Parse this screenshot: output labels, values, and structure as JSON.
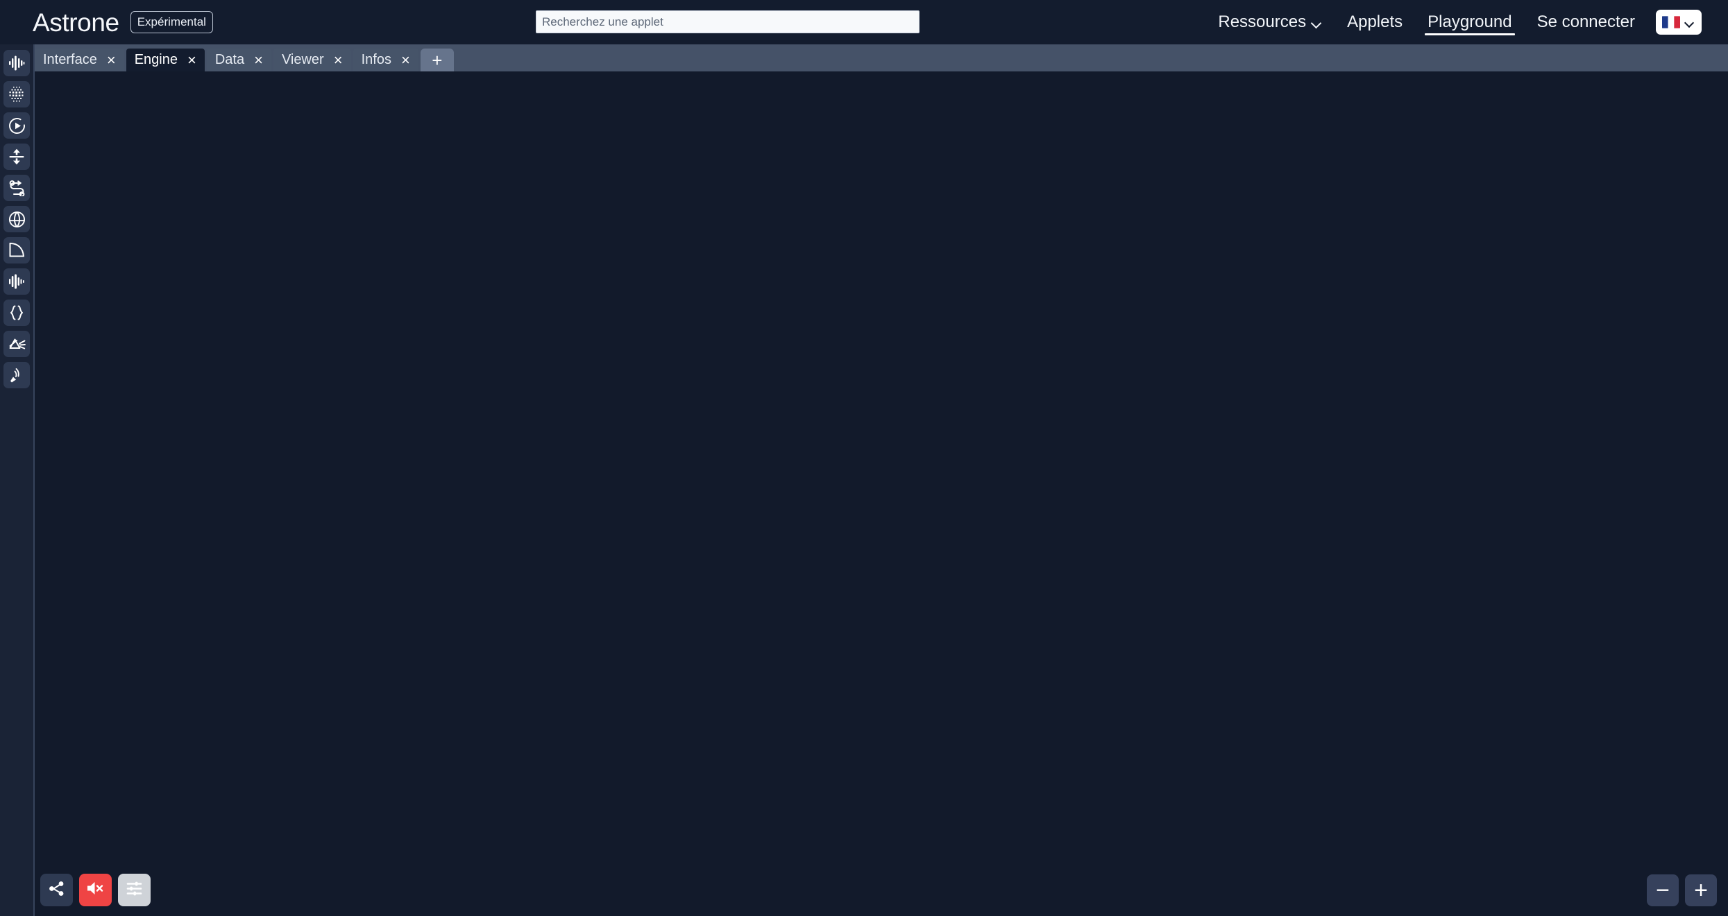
{
  "header": {
    "brand_title": "Astrone",
    "brand_badge": "Expérimental",
    "search": {
      "placeholder": "Recherchez une applet",
      "value": "",
      "icon": "search-icon"
    },
    "nav": [
      {
        "label": "Ressources",
        "has_chevron": true,
        "active": false,
        "icon": "chevron-down-icon"
      },
      {
        "label": "Applets",
        "has_chevron": false,
        "active": false
      },
      {
        "label": "Playground",
        "has_chevron": false,
        "active": true
      },
      {
        "label": "Se connecter",
        "has_chevron": false,
        "active": false
      }
    ],
    "language": {
      "selected": "fr",
      "flag_icon": "france-flag-icon",
      "chevron_icon": "chevron-down-icon"
    }
  },
  "tabs": {
    "items": [
      {
        "label": "Interface",
        "active": false,
        "close": "×"
      },
      {
        "label": "Engine",
        "active": true,
        "close": "×"
      },
      {
        "label": "Data",
        "active": false,
        "close": "×"
      },
      {
        "label": "Viewer",
        "active": false,
        "close": "×"
      },
      {
        "label": "Infos",
        "active": false,
        "close": "×"
      }
    ],
    "add_label": "+"
  },
  "sidebar": {
    "items": [
      {
        "icon": "waveform-icon",
        "label": "Waveform"
      },
      {
        "icon": "dot-matrix-icon",
        "label": "Dot matrix"
      },
      {
        "icon": "play-circle-icon",
        "label": "Play"
      },
      {
        "icon": "vertical-arrows-icon",
        "label": "Vertical arrows"
      },
      {
        "icon": "link-nodes-icon",
        "label": "Linked nodes"
      },
      {
        "icon": "globe-icon",
        "label": "Globe"
      },
      {
        "icon": "angle-curve-icon",
        "label": "Angle curve"
      },
      {
        "icon": "spectrum-icon",
        "label": "Spectrum"
      },
      {
        "icon": "braces-icon",
        "label": "Code braces"
      },
      {
        "icon": "prism-icon",
        "label": "Prism"
      },
      {
        "icon": "radar-icon",
        "label": "Radar"
      }
    ]
  },
  "bottom_left": {
    "buttons": [
      {
        "icon": "share-icon",
        "label": "Share",
        "color": "#2e3a52"
      },
      {
        "icon": "mute-icon",
        "label": "Mute",
        "color": "#ef4444"
      },
      {
        "icon": "settings-sliders-icon",
        "label": "Settings",
        "color": "#cfd3d8"
      }
    ]
  },
  "bottom_right": {
    "zoom_out_label": "−",
    "zoom_in_label": "+"
  },
  "colors": {
    "header_bg": "#131c2e",
    "tabbar_bg": "#455268",
    "canvas_bg": "#121a2b",
    "sidebar_bg": "#1a2336",
    "icon_btn_bg": "#2e3a52",
    "accent_red": "#ef4444",
    "text_light": "#f2f5f9"
  }
}
